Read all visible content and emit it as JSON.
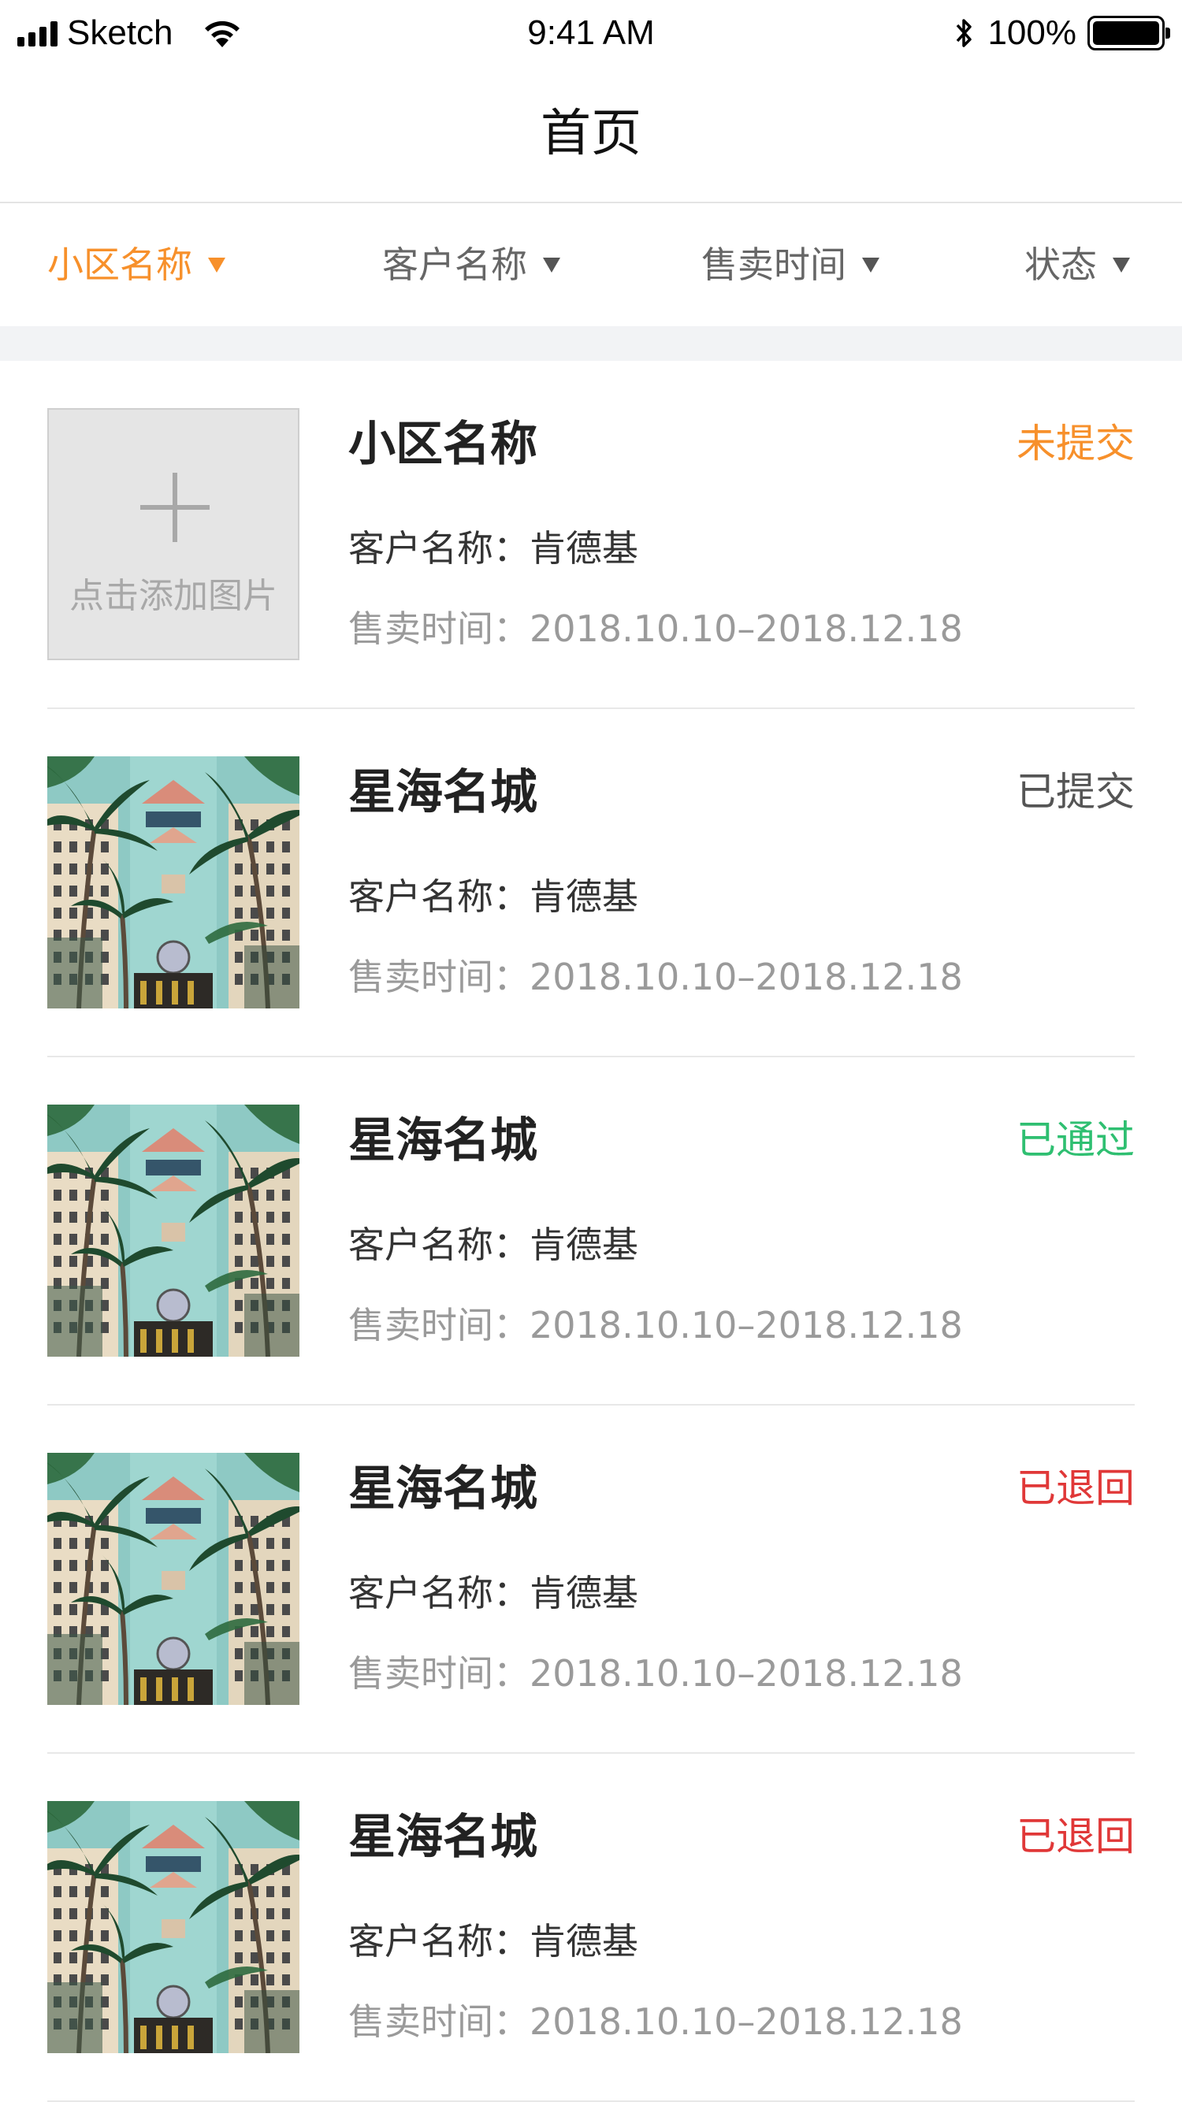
{
  "status_bar": {
    "carrier": "Sketch",
    "time": "9:41 AM",
    "battery": "100%"
  },
  "nav": {
    "title": "首页"
  },
  "filters": [
    {
      "label": "小区名称",
      "active": true
    },
    {
      "label": "客户名称",
      "active": false
    },
    {
      "label": "售卖时间",
      "active": false
    },
    {
      "label": "状态",
      "active": false
    }
  ],
  "colors": {
    "accent": "#f7902b",
    "status_unsubmitted": "#f7902b",
    "status_submitted": "#555555",
    "status_passed": "#2fbf71",
    "status_returned": "#e03838"
  },
  "items": [
    {
      "title": "小区名称",
      "status": "未提交",
      "status_color": "#f7902b",
      "customer": "客户名称：肯德基",
      "sale_time": "售卖时间：2018.10.10–2018.12.18",
      "has_image": false,
      "placeholder_text": "点击添加图片"
    },
    {
      "title": "星海名城",
      "status": "已提交",
      "status_color": "#555555",
      "customer": "客户名称：肯德基",
      "sale_time": "售卖时间：2018.10.10–2018.12.18",
      "has_image": true
    },
    {
      "title": "星海名城",
      "status": "已通过",
      "status_color": "#2fbf71",
      "customer": "客户名称：肯德基",
      "sale_time": "售卖时间：2018.10.10–2018.12.18",
      "has_image": true
    },
    {
      "title": "星海名城",
      "status": "已退回",
      "status_color": "#e03838",
      "customer": "客户名称：肯德基",
      "sale_time": "售卖时间：2018.10.10–2018.12.18",
      "has_image": true
    },
    {
      "title": "星海名城",
      "status": "已退回",
      "status_color": "#e03838",
      "customer": "客户名称：肯德基",
      "sale_time": "售卖时间：2018.10.10–2018.12.18",
      "has_image": true
    }
  ]
}
